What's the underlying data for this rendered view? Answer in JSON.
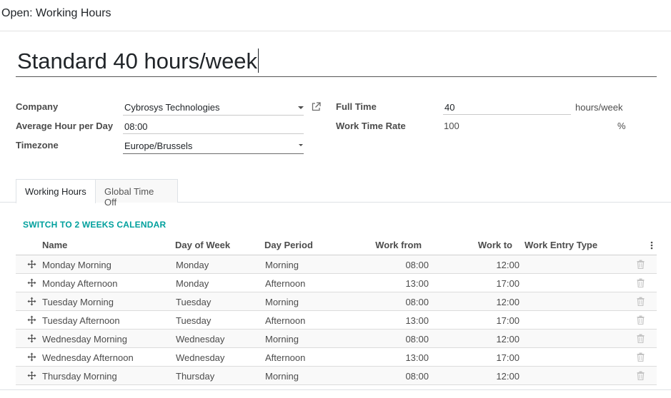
{
  "dialog": {
    "title": "Open: Working Hours"
  },
  "record": {
    "name": "Standard 40 hours/week"
  },
  "fields": {
    "company": {
      "label": "Company",
      "value": "Cybrosys Technologies"
    },
    "average_hour": {
      "label": "Average Hour per Day",
      "value": "08:00"
    },
    "timezone": {
      "label": "Timezone",
      "value": "Europe/Brussels"
    },
    "full_time": {
      "label": "Full Time",
      "value": "40",
      "unit": "hours/week"
    },
    "work_time_rate": {
      "label": "Work Time Rate",
      "value": "100",
      "unit": "%"
    }
  },
  "tabs": [
    {
      "label": "Working Hours",
      "active": true
    },
    {
      "label": "Global Time Off",
      "active": false
    }
  ],
  "switch_link": "SWITCH TO 2 WEEKS CALENDAR",
  "table": {
    "columns": [
      "Name",
      "Day of Week",
      "Day Period",
      "Work from",
      "Work to",
      "Work Entry Type"
    ],
    "rows": [
      {
        "name": "Monday Morning",
        "day": "Monday",
        "period": "Morning",
        "from": "08:00",
        "to": "12:00",
        "entry_type": ""
      },
      {
        "name": "Monday Afternoon",
        "day": "Monday",
        "period": "Afternoon",
        "from": "13:00",
        "to": "17:00",
        "entry_type": ""
      },
      {
        "name": "Tuesday Morning",
        "day": "Tuesday",
        "period": "Morning",
        "from": "08:00",
        "to": "12:00",
        "entry_type": ""
      },
      {
        "name": "Tuesday Afternoon",
        "day": "Tuesday",
        "period": "Afternoon",
        "from": "13:00",
        "to": "17:00",
        "entry_type": ""
      },
      {
        "name": "Wednesday Morning",
        "day": "Wednesday",
        "period": "Morning",
        "from": "08:00",
        "to": "12:00",
        "entry_type": ""
      },
      {
        "name": "Wednesday Afternoon",
        "day": "Wednesday",
        "period": "Afternoon",
        "from": "13:00",
        "to": "17:00",
        "entry_type": ""
      },
      {
        "name": "Thursday Morning",
        "day": "Thursday",
        "period": "Morning",
        "from": "08:00",
        "to": "12:00",
        "entry_type": ""
      }
    ]
  },
  "colors": {
    "link": "#00a09d",
    "text": "#4c4c4c"
  },
  "icons": {
    "row_handle": "drag-handle-icon",
    "row_delete": "trash-icon",
    "optional_columns": "kebab-icon",
    "external_link": "external-link-icon"
  }
}
